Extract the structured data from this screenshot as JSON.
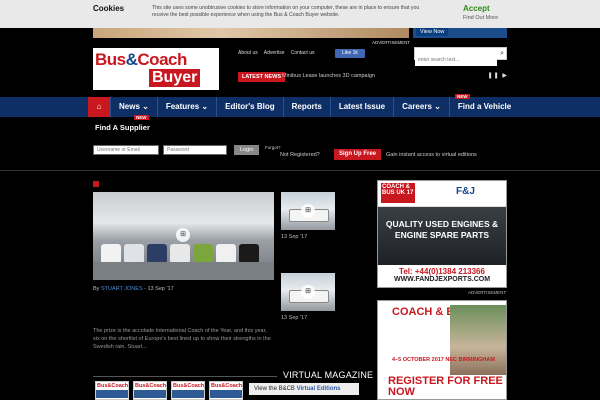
{
  "cookie": {
    "title": "Cookies",
    "message": "This site uses some unobtrusive cookies to store information on your computer, these are in place to ensure that you receive the best possible experience when using the Bus & Coach Buyer website.",
    "accept": "Accept",
    "more": "Find Out More"
  },
  "banner": {
    "view_now": "View Now",
    "advert": "ADVERTISEMENT"
  },
  "header": {
    "logo_line1_a": "Bus",
    "logo_amp": "&",
    "logo_line1_b": "Coach",
    "logo_line2": "Buyer",
    "links": [
      "About us",
      "Advertise",
      "Contact us"
    ],
    "like": "Like 1k",
    "search_placeholder": "enter search text...",
    "latest_tag": "LATEST NEWS",
    "latest_text": "Minibus Lease launches 3D campaign",
    "latest_controls": "❚❚ ▶"
  },
  "nav": {
    "home_icon": "home-icon",
    "items": [
      "News",
      "Features",
      "Editor's Blog",
      "Reports",
      "Latest Issue",
      "Careers",
      "Find a Vehicle"
    ],
    "new_badge": "NEW",
    "find_supplier": "Find A Supplier"
  },
  "login": {
    "username_placeholder": "Username or Email",
    "password_placeholder": "Password",
    "login_button": "Login",
    "forgot": "Forgot?",
    "not_registered": "Not Registered?",
    "signup": "Sign Up Free",
    "gain": "Gain instant access to virtual editions"
  },
  "feature": {
    "by": "By",
    "author": "STUART JONES",
    "date": "- 13 Sep '17",
    "excerpt": "The prize is the accolade International Coach of the Year, and this year, six on the shortlist of Europe's best lined up to show their strengths in the Swedish rain. Stuart..."
  },
  "thumbs": [
    {
      "date": "13 Sep '17"
    },
    {
      "date": "13 Sep '17"
    }
  ],
  "magazine": {
    "title": "VIRTUAL MAGAZINE",
    "cover_title": "Bus&Coach",
    "button_prefix": "View the B&CB",
    "button_highlight": "Virtual Editions"
  },
  "ads": {
    "ad1": {
      "coach_logo": "COACH & BUS UK 17",
      "company": "F&J",
      "headline": "QUALITY USED ENGINES & ENGINE SPARE PARTS",
      "phone": "Tel: +44(0)1384 213366",
      "web": "WWW.FANDJEXPORTS.COM"
    },
    "ad_label": "ADVERTISEMENT",
    "ad2": {
      "logo": "COACH & BUS UK 17",
      "dates": "4–5 OCTOBER 2017 NEC BIRMINGHAM",
      "register": "REGISTER FOR FREE NOW"
    }
  },
  "colors": {
    "brand_red": "#c8171e",
    "nav_blue": "#0e2f66",
    "accept_green": "#2f8a1e"
  }
}
